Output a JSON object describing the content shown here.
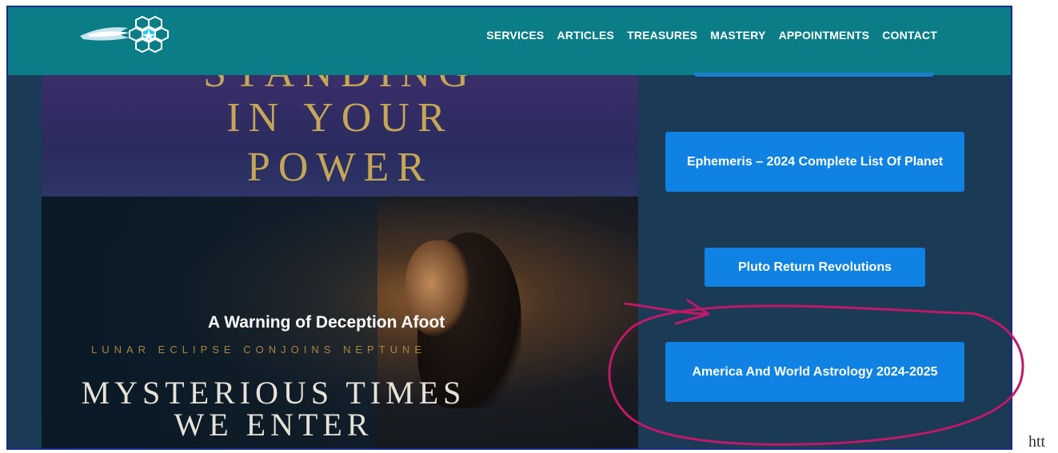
{
  "header": {
    "nav": [
      "SERVICES",
      "ARTICLES",
      "TREASURES",
      "MASTERY",
      "APPOINTMENTS",
      "CONTACT"
    ]
  },
  "hero_power": {
    "cut_line": "STANDING",
    "line1": "IN YOUR",
    "line2": "POWER"
  },
  "hero_deception": {
    "title": "A Warning of Deception Afoot",
    "subtitle": "LUNAR ECLIPSE CONJOINS NEPTUNE",
    "line1": "MYSTERIOUS TIMES",
    "line2": "WE ENTER"
  },
  "sidebar": {
    "buttons": [
      "Ephemeris – 2024 Complete List Of Planet",
      "Pluto Return Revolutions",
      "America And World Astrology 2024-2025"
    ]
  },
  "colors": {
    "header_bg": "#0b7d87",
    "page_bg": "#1a3a55",
    "button_bg": "#0f82e3",
    "annotation": "#c0186a",
    "gold_text": "#c5a657"
  },
  "corner_text": "htt"
}
